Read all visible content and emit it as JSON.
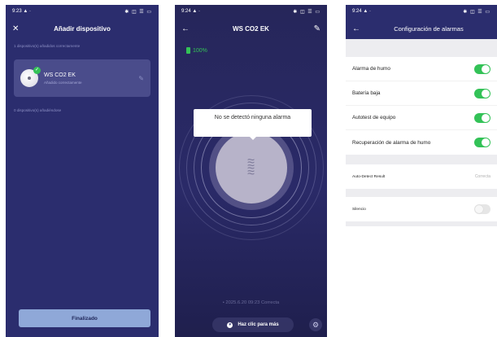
{
  "panel1": {
    "status": {
      "time": "9:23 ▲ ·",
      "icons": "✱ ◫ ☰ ▭"
    },
    "header": {
      "title": "Añadir dispositivo"
    },
    "added_label": "1 dispositivo(s) añadidos correctamente",
    "device": {
      "name": "WS CO2 EK",
      "status": "Añadido correctamente"
    },
    "adding_label": "0 dispositivo(s) añadiéndose",
    "finish_button": "Finalizado"
  },
  "panel2": {
    "status": {
      "time": "9:24 ▲ ·",
      "icons": "✱ ◫ ☰ ▭"
    },
    "header": {
      "title": "WS CO2 EK"
    },
    "battery": "100%",
    "tooltip": "No se detectó ninguna alarma",
    "record": "• 2025.6.20 09:23 Correcta",
    "more_button": "Haz clic para más"
  },
  "panel3": {
    "status": {
      "time": "9:24 ▲ ·",
      "icons": "✱ ◫ ☰ ▭"
    },
    "header": {
      "title": "Configuración de alarmas"
    },
    "toggles": [
      {
        "label": "Alarma de humo",
        "on": true
      },
      {
        "label": "Batería baja",
        "on": true
      },
      {
        "label": "Autotest de equipo",
        "on": true
      },
      {
        "label": "Recuperación de alarma de humo",
        "on": true
      }
    ],
    "auto_detect": {
      "label": "Auto-Detect Result",
      "value": "Correcta"
    },
    "silence": {
      "label": "Silencio",
      "on": false
    }
  },
  "colors": {
    "primary_dark": "#2b2d6e",
    "toggle_on": "#33c257",
    "battery": "#33c257",
    "finish_button": "#8fa8d8"
  }
}
